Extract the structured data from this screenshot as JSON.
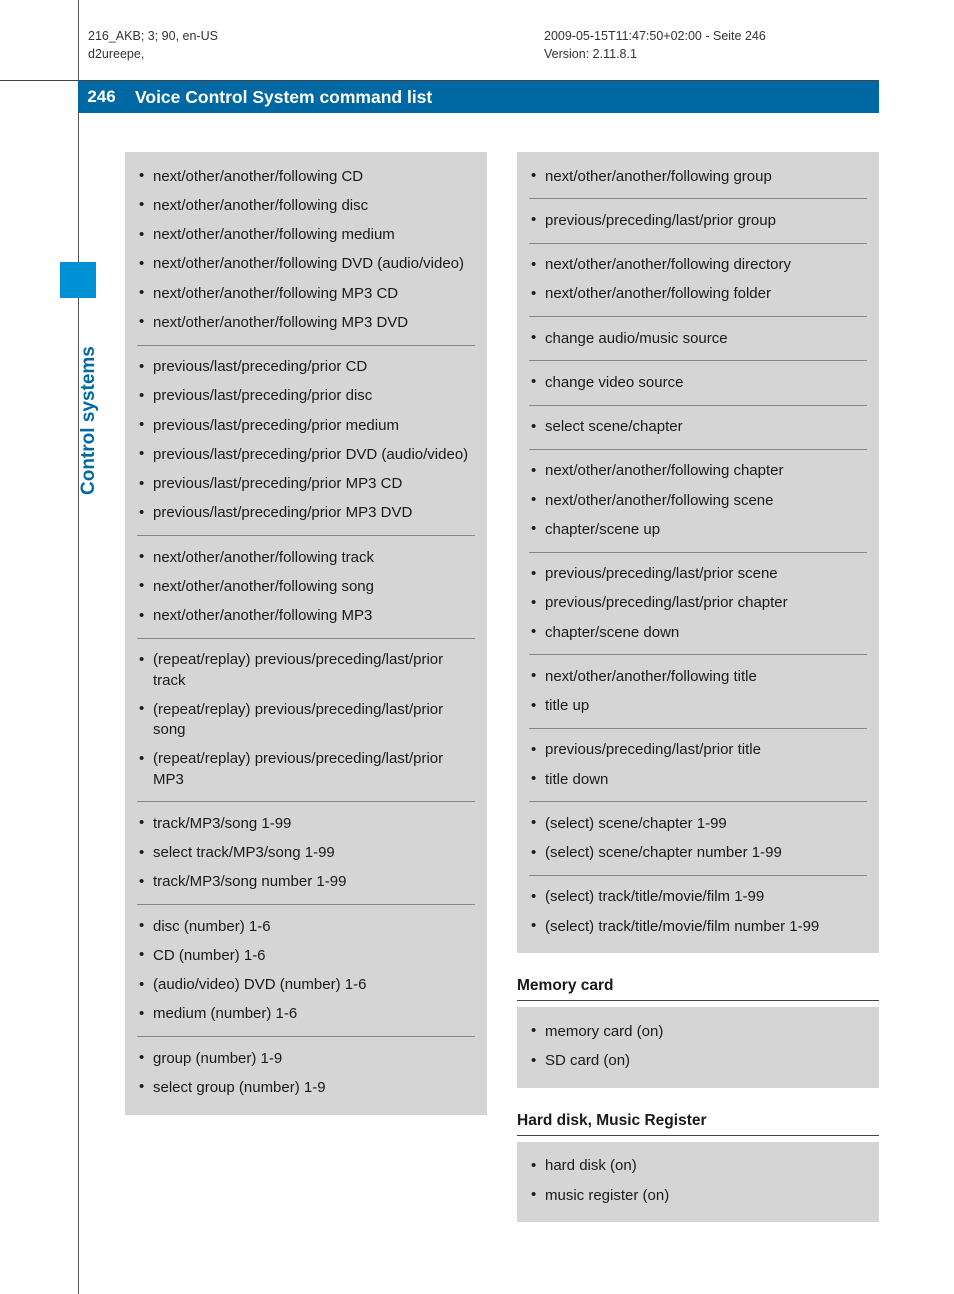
{
  "header": {
    "left_line1": "216_AKB; 3; 90, en-US",
    "left_line2": "d2ureepe,",
    "right_line1": "2009-05-15T11:47:50+02:00 - Seite 246",
    "right_line2": "Version: 2.11.8.1"
  },
  "page_number": "246",
  "page_title": "Voice Control System command list",
  "side_tab": "Control systems",
  "left_column": {
    "groups": [
      [
        "next/other/another/following CD",
        "next/other/another/following disc",
        "next/other/another/following medium",
        "next/other/another/following DVD (audio/video)",
        "next/other/another/following MP3 CD",
        "next/other/another/following MP3 DVD"
      ],
      [
        "previous/last/preceding/prior CD",
        "previous/last/preceding/prior disc",
        "previous/last/preceding/prior medium",
        "previous/last/preceding/prior DVD (audio/video)",
        "previous/last/preceding/prior MP3 CD",
        "previous/last/preceding/prior MP3 DVD"
      ],
      [
        "next/other/another/following track",
        "next/other/another/following song",
        "next/other/another/following MP3"
      ],
      [
        "(repeat/replay) previous/preceding/last/prior track",
        "(repeat/replay) previous/preceding/last/prior song",
        "(repeat/replay) previous/preceding/last/prior MP3"
      ],
      [
        "track/MP3/song 1-99",
        "select track/MP3/song 1-99",
        "track/MP3/song number 1-99"
      ],
      [
        "disc (number) 1-6",
        "CD (number) 1-6",
        "(audio/video) DVD (number) 1-6",
        "medium (number) 1-6"
      ],
      [
        "group (number) 1-9",
        "select group (number) 1-9"
      ]
    ]
  },
  "right_column_block1": {
    "groups": [
      [
        "next/other/another/following group"
      ],
      [
        "previous/preceding/last/prior group"
      ],
      [
        "next/other/another/following directory",
        "next/other/another/following folder"
      ],
      [
        "change audio/music source"
      ],
      [
        "change video source"
      ],
      [
        "select scene/chapter"
      ],
      [
        "next/other/another/following chapter",
        "next/other/another/following scene",
        "chapter/scene up"
      ],
      [
        "previous/preceding/last/prior scene",
        "previous/preceding/last/prior chapter",
        "chapter/scene down"
      ],
      [
        "next/other/another/following title",
        "title up"
      ],
      [
        "previous/preceding/last/prior title",
        "title down"
      ],
      [
        "(select) scene/chapter 1-99",
        "(select) scene/chapter number 1-99"
      ],
      [
        "(select) track/title/movie/film 1-99",
        "(select) track/title/movie/film number 1-99"
      ]
    ]
  },
  "right_column_block2": {
    "heading": "Memory card",
    "items": [
      "memory card (on)",
      "SD card (on)"
    ]
  },
  "right_column_block3": {
    "heading": "Hard disk, Music Register",
    "items": [
      "hard disk (on)",
      "music register (on)"
    ]
  }
}
